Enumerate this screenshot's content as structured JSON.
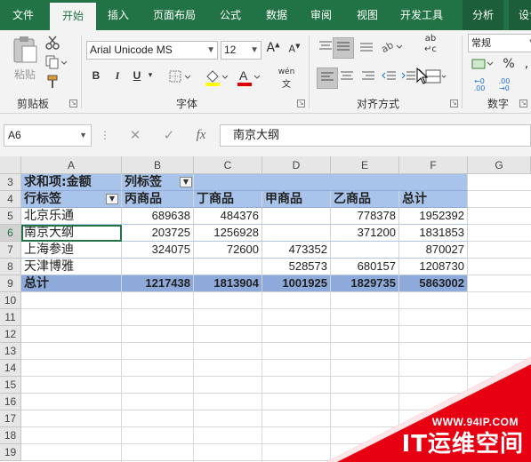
{
  "tabs": [
    "文件",
    "开始",
    "插入",
    "页面布局",
    "公式",
    "数据",
    "审阅",
    "视图",
    "开发工具",
    "分析",
    "设计"
  ],
  "ribbon": {
    "clipboard": {
      "paste": "粘贴",
      "label": "剪贴板"
    },
    "font": {
      "name": "Arial Unicode MS",
      "size": "12",
      "label": "字体",
      "bold": "B",
      "italic": "I",
      "underline": "U"
    },
    "alignment": {
      "label": "对齐方式"
    },
    "number": {
      "format": "常规",
      "label": "数字",
      "percent": "%",
      "comma": ","
    }
  },
  "formula_bar": {
    "name_box": "A6",
    "fx": "fx",
    "value": "南京大纲"
  },
  "columns": [
    "A",
    "B",
    "C",
    "D",
    "E",
    "F",
    "G"
  ],
  "rows": [
    "3",
    "4",
    "5",
    "6",
    "7",
    "8",
    "9",
    "10",
    "11",
    "12",
    "13",
    "14",
    "15",
    "16",
    "17",
    "18",
    "19"
  ],
  "pivot": {
    "corner": "求和项:金额",
    "col_label": "列标签",
    "row_label": "行标签",
    "headers": [
      "丙商品",
      "丁商品",
      "甲商品",
      "乙商品",
      "总计"
    ],
    "rows": [
      {
        "name": "北京乐通",
        "values": [
          "689638",
          "484376",
          "",
          "778378",
          "1952392"
        ]
      },
      {
        "name": "南京大纲",
        "values": [
          "203725",
          "1256928",
          "",
          "371200",
          "1831853"
        ]
      },
      {
        "name": "上海参迪",
        "values": [
          "324075",
          "72600",
          "473352",
          "",
          "870027"
        ]
      },
      {
        "name": "天津博雅",
        "values": [
          "",
          "",
          "528573",
          "680157",
          "1208730"
        ]
      }
    ],
    "total_label": "总计",
    "totals": [
      "1217438",
      "1813904",
      "1001925",
      "1829735",
      "5863002"
    ]
  },
  "watermark": {
    "url": "WWW.94IP.COM",
    "brand": "IT运维空间"
  }
}
